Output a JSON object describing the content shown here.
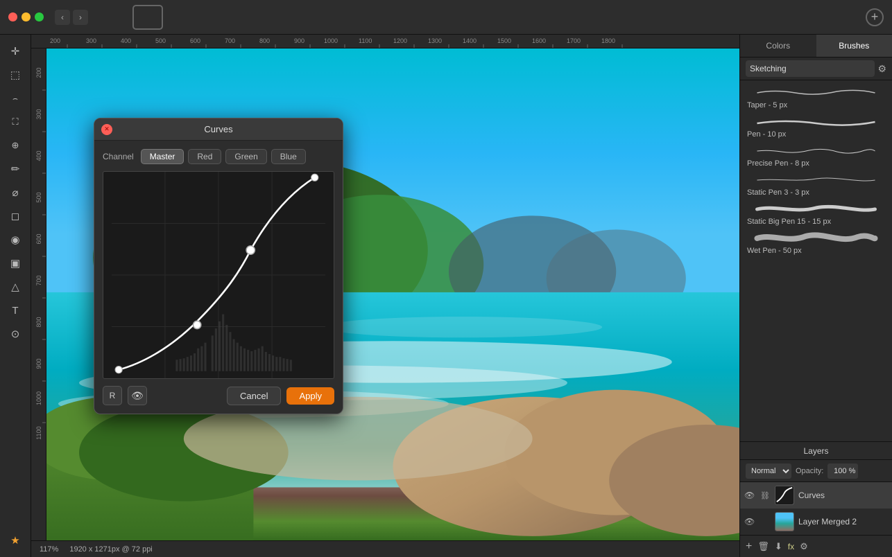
{
  "titlebar": {
    "tabs": [
      {
        "id": "tab1",
        "type": "bw",
        "active": false
      },
      {
        "id": "tab2",
        "type": "color",
        "active": true
      }
    ],
    "plus_label": "+"
  },
  "left_toolbar": {
    "tools": [
      {
        "id": "move",
        "icon": "✛",
        "active": false
      },
      {
        "id": "select-rect",
        "icon": "⬚",
        "active": false
      },
      {
        "id": "select-lasso",
        "icon": "⌒",
        "active": false
      },
      {
        "id": "crop",
        "icon": "⛶",
        "active": false
      },
      {
        "id": "eyedropper",
        "icon": "⊕",
        "active": false
      },
      {
        "id": "pen",
        "icon": "✏",
        "active": false
      },
      {
        "id": "brush",
        "icon": "⌀",
        "active": false
      },
      {
        "id": "eraser",
        "icon": "◻",
        "active": false
      },
      {
        "id": "fill",
        "icon": "◉",
        "active": false
      },
      {
        "id": "gradient",
        "icon": "▣",
        "active": false
      },
      {
        "id": "shapes",
        "icon": "△",
        "active": false
      },
      {
        "id": "text",
        "icon": "T",
        "active": false
      },
      {
        "id": "zoom",
        "icon": "⊙",
        "active": false
      },
      {
        "id": "star",
        "icon": "★",
        "active": false
      }
    ]
  },
  "right_panel": {
    "tabs": [
      {
        "id": "colors",
        "label": "Colors",
        "active": false
      },
      {
        "id": "brushes",
        "label": "Brushes",
        "active": true
      }
    ],
    "brush_preset": "Sketching",
    "brushes": [
      {
        "id": "taper",
        "name": "Taper - 5 px"
      },
      {
        "id": "pen",
        "name": "Pen - 10 px"
      },
      {
        "id": "precise-pen",
        "name": "Precise Pen - 8 px"
      },
      {
        "id": "static-pen3",
        "name": "Static Pen 3 - 3 px"
      },
      {
        "id": "static-big-pen",
        "name": "Static Big Pen 15 - 15 px"
      },
      {
        "id": "wet-pen",
        "name": "Wet Pen - 50 px"
      }
    ],
    "layers": {
      "header": "Layers",
      "blend_mode": "Normal",
      "opacity_label": "Opacity:",
      "opacity_value": "100 %",
      "items": [
        {
          "id": "curves-layer",
          "name": "Curves",
          "type": "curves",
          "visible": true,
          "active": true
        },
        {
          "id": "merged-layer",
          "name": "Layer Merged 2",
          "type": "photo",
          "visible": true,
          "active": false
        }
      ]
    }
  },
  "canvas": {
    "zoom_label": "117%",
    "dimensions_label": "1920 x 1271px @ 72 ppi"
  },
  "curves_dialog": {
    "title": "Curves",
    "channel_label": "Channel",
    "channels": [
      "Master",
      "Red",
      "Green",
      "Blue"
    ],
    "active_channel": "Master",
    "r_button": "R",
    "cancel_label": "Cancel",
    "apply_label": "Apply"
  }
}
